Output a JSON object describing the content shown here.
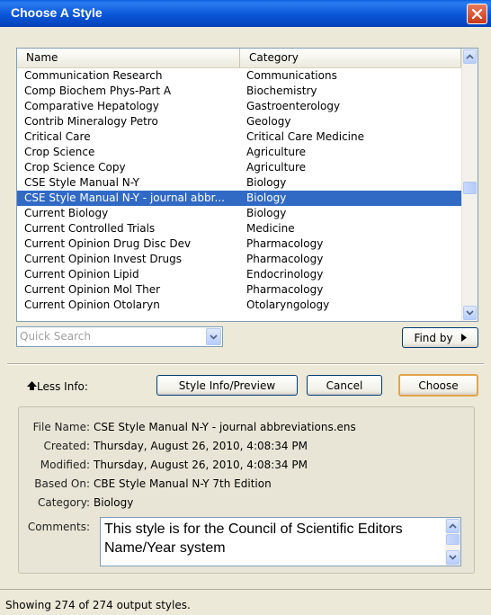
{
  "window": {
    "title": "Choose A Style"
  },
  "list": {
    "columns": [
      "Name",
      "Category"
    ],
    "rows": [
      {
        "name": "Communication Research",
        "category": "Communications"
      },
      {
        "name": "Comp Biochem Phys-Part A",
        "category": "Biochemistry"
      },
      {
        "name": "Comparative Hepatology",
        "category": "Gastroenterology"
      },
      {
        "name": "Contrib Mineralogy Petro",
        "category": "Geology"
      },
      {
        "name": "Critical Care",
        "category": "Critical Care Medicine"
      },
      {
        "name": "Crop Science",
        "category": "Agriculture"
      },
      {
        "name": "Crop Science Copy",
        "category": "Agriculture"
      },
      {
        "name": "CSE Style Manual N-Y",
        "category": "Biology"
      },
      {
        "name": "CSE Style Manual N-Y  - journal abbr...",
        "category": "Biology",
        "selected": true
      },
      {
        "name": "Current Biology",
        "category": "Biology"
      },
      {
        "name": "Current Controlled Trials",
        "category": "Medicine"
      },
      {
        "name": "Current Opinion Drug Disc Dev",
        "category": "Pharmacology"
      },
      {
        "name": "Current Opinion Invest Drugs",
        "category": "Pharmacology"
      },
      {
        "name": "Current Opinion Lipid",
        "category": "Endocrinology"
      },
      {
        "name": "Current Opinion Mol Ther",
        "category": "Pharmacology"
      },
      {
        "name": "Current Opinion Otolaryn",
        "category": "Otolaryngology"
      }
    ],
    "selected_color": "#316ac5"
  },
  "search": {
    "placeholder": "Quick Search",
    "find_by_label": "Find by"
  },
  "actions": {
    "less_info_label": "Less Info:",
    "style_info_label": "Style Info/Preview",
    "cancel_label": "Cancel",
    "choose_label": "Choose"
  },
  "info": {
    "file_name_label": "File Name:",
    "file_name": "CSE Style Manual N-Y  - journal abbreviations.ens",
    "created_label": "Created:",
    "created": "Thursday, August 26, 2010, 4:08:34 PM",
    "modified_label": "Modified:",
    "modified": "Thursday, August 26, 2010, 4:08:34 PM",
    "based_on_label": "Based On:",
    "based_on": "CBE Style Manual N-Y 7th Edition",
    "category_label": "Category:",
    "category": "Biology",
    "comments_label": "Comments:",
    "comments": "This style is for the Council of Scientific Editors Name/Year system"
  },
  "status": {
    "text": "Showing 274 of 274 output styles."
  }
}
